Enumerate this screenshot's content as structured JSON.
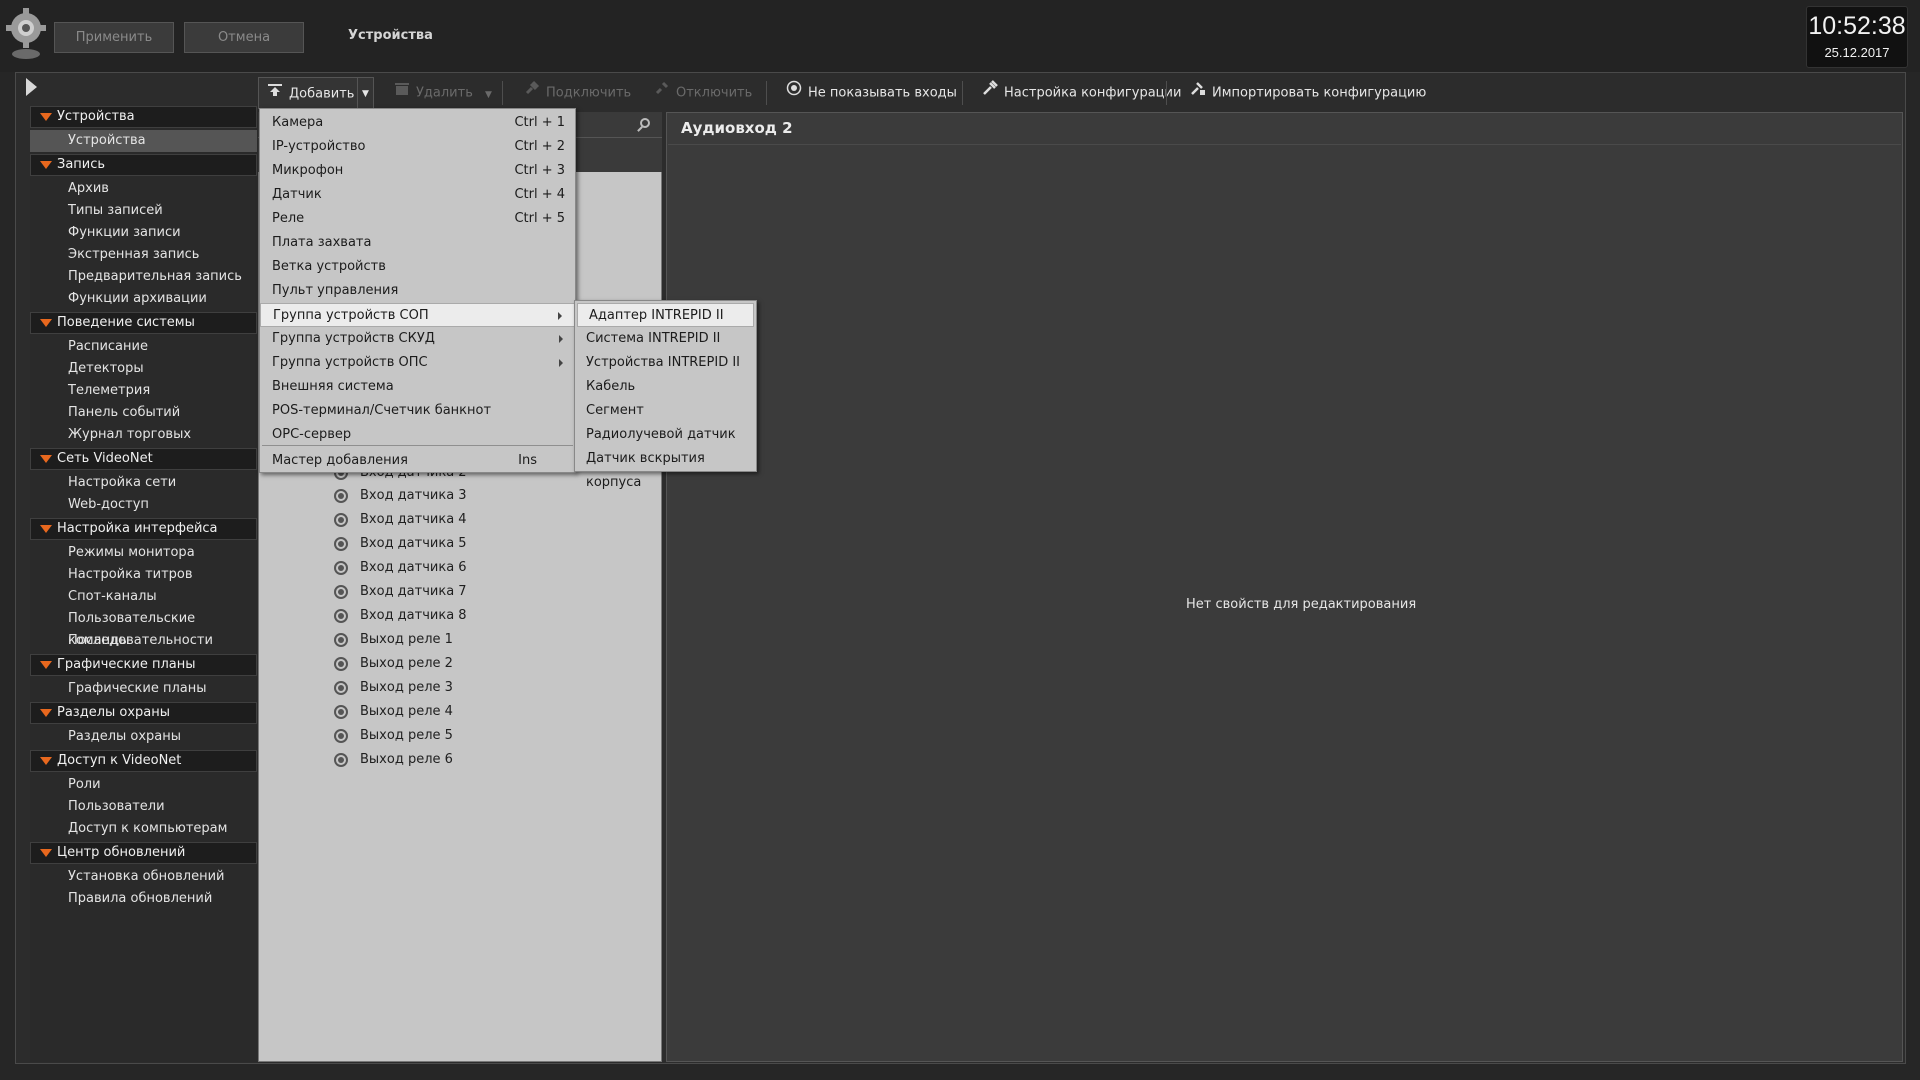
{
  "header": {
    "apply_label": "Применить",
    "cancel_label": "Отмена",
    "title": "Устройства",
    "clock_time": "10:52:38",
    "clock_date": "25.12.2017"
  },
  "toolbar": {
    "add": "Добавить",
    "delete": "Удалить",
    "connect": "Подключить",
    "disconnect": "Отключить",
    "hide_inputs": "Не показывать входы",
    "config_setup": "Настройка конфигурации",
    "import_config": "Импортировать конфигурацию"
  },
  "sidebar": [
    {
      "label": "Устройства",
      "items": [
        "Устройства"
      ]
    },
    {
      "label": "Запись",
      "items": [
        "Архив",
        "Типы записей",
        "Функции записи",
        "Экстренная запись",
        "Предварительная запись",
        "Функции архивации"
      ]
    },
    {
      "label": "Поведение системы",
      "items": [
        "Расписание",
        "Детекторы",
        "Телеметрия",
        "Панель событий",
        "Журнал торговых операций"
      ]
    },
    {
      "label": "Сеть VideoNet",
      "items": [
        "Настройка сети",
        "Web-доступ"
      ]
    },
    {
      "label": "Настройка интерфейса",
      "items": [
        "Режимы монитора",
        "Настройка титров",
        "Спот-каналы",
        "Пользовательские команды",
        "Последовательности"
      ]
    },
    {
      "label": "Графические планы",
      "items": [
        "Графические планы"
      ]
    },
    {
      "label": "Разделы охраны",
      "items": [
        "Разделы охраны"
      ]
    },
    {
      "label": "Доступ к VideoNet",
      "items": [
        "Роли",
        "Пользователи",
        "Доступ к компьютерам"
      ]
    },
    {
      "label": "Центр обновлений",
      "items": [
        "Установка обновлений",
        "Правила обновлений"
      ]
    }
  ],
  "tree": {
    "partial_item": "Вход датчика 2",
    "items": [
      "Вход датчика 3",
      "Вход датчика 4",
      "Вход датчика 5",
      "Вход датчика 6",
      "Вход датчика 7",
      "Вход датчика 8",
      "Выход реле 1",
      "Выход реле 2",
      "Выход реле 3",
      "Выход реле 4",
      "Выход реле 5",
      "Выход реле 6"
    ]
  },
  "properties": {
    "title": "Аудиовход 2",
    "empty_text": "Нет свойств для редактирования"
  },
  "add_menu": {
    "items": [
      {
        "label": "Камера",
        "shortcut": "Ctrl + 1"
      },
      {
        "label": "IP-устройство",
        "shortcut": "Ctrl + 2"
      },
      {
        "label": "Микрофон",
        "shortcut": "Ctrl + 3"
      },
      {
        "label": "Датчик",
        "shortcut": "Ctrl + 4"
      },
      {
        "label": "Реле",
        "shortcut": "Ctrl + 5"
      },
      {
        "label": "Плата захвата",
        "shortcut": ""
      },
      {
        "label": "Ветка устройств",
        "shortcut": ""
      },
      {
        "label": "Пульт управления",
        "shortcut": ""
      },
      {
        "label": "Группа устройств СОП",
        "shortcut": ""
      },
      {
        "label": "Группа устройств СКУД",
        "shortcut": ""
      },
      {
        "label": "Группа устройств ОПС",
        "shortcut": ""
      },
      {
        "label": "Внешняя система",
        "shortcut": ""
      },
      {
        "label": "POS-терминал/Счетчик банкнот",
        "shortcut": ""
      },
      {
        "label": "OPC-сервер",
        "shortcut": ""
      }
    ],
    "wizard": {
      "label": "Мастер добавления",
      "shortcut": "Ins"
    }
  },
  "sub_menu": {
    "items": [
      "Адаптер INTREPID II",
      "Система INTREPID II",
      "Устройства INTREPID II",
      "Кабель",
      "Сегмент",
      "Радиолучевой датчик",
      "Датчик вскрытия корпуса"
    ]
  }
}
